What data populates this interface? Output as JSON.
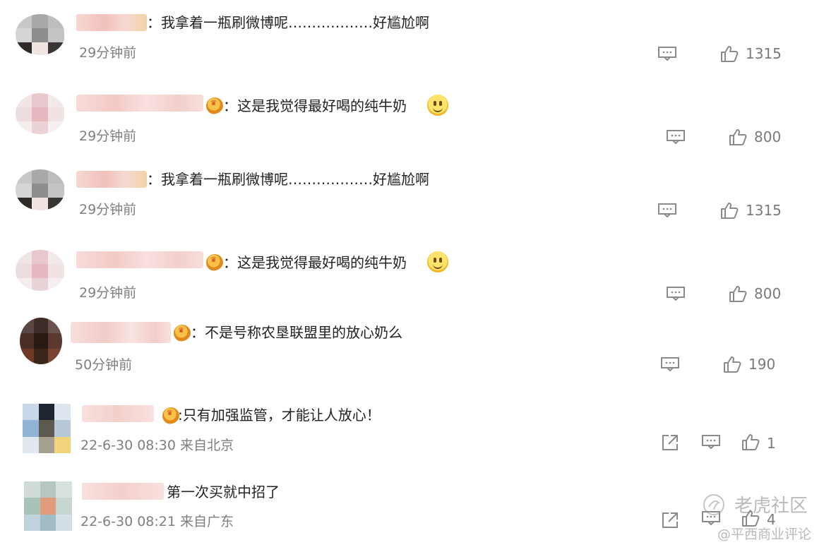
{
  "comments": [
    {
      "text": "：我拿着一瓶刷微博呢………………好尴尬啊",
      "time": "29分钟前",
      "likes": "1315"
    },
    {
      "text": "：这是我觉得最好喝的纯牛奶",
      "time": "29分钟前",
      "likes": "800"
    },
    {
      "text": "：我拿着一瓶刷微博呢………………好尴尬啊",
      "time": "29分钟前",
      "likes": "1315"
    },
    {
      "text": "：这是我觉得最好喝的纯牛奶",
      "time": "29分钟前",
      "likes": "800"
    },
    {
      "text": "：不是号称农垦联盟里的放心奶么",
      "time": "50分钟前",
      "likes": "190"
    },
    {
      "text": ":只有加强监管，才能让人放心！",
      "time": "22-6-30 08:30 来自北京",
      "likes": "1"
    },
    {
      "text": "第一次买就中招了",
      "time": "22-6-30 08:21 来自广东",
      "likes": "4"
    }
  ],
  "icons": {
    "reply": "comment-icon",
    "like": "thumbs-up-icon",
    "share": "share-icon",
    "badge": "crown-badge-icon",
    "emoji": "smile-emoji-icon"
  },
  "watermark": {
    "line1": "老虎社区",
    "line2": "@平西商业评论"
  },
  "colors": {
    "text": "#222222",
    "meta": "#7f7f7f",
    "icon": "#8a8a8a"
  }
}
